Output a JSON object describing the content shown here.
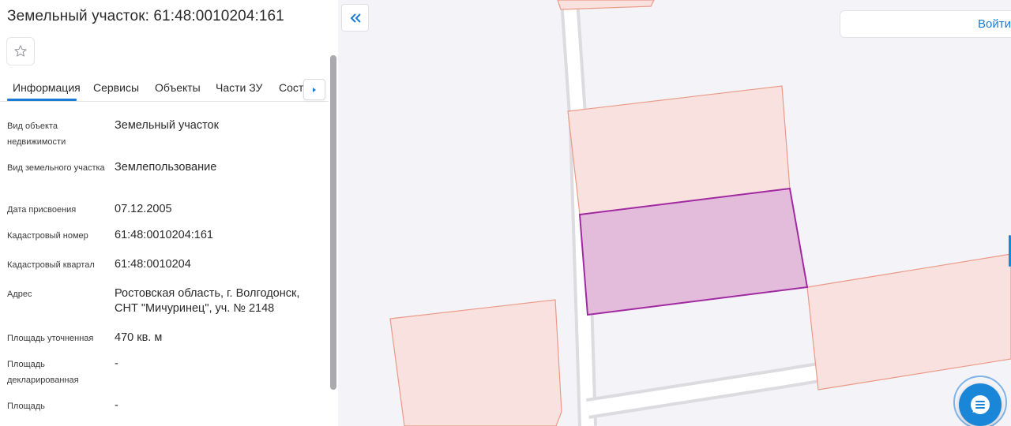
{
  "panel": {
    "title": "Земельный участок: 61:48:0010204:161",
    "tabs": [
      {
        "label": "Информация",
        "active": true
      },
      {
        "label": "Сервисы"
      },
      {
        "label": "Объекты"
      },
      {
        "label": "Части ЗУ"
      },
      {
        "label": "Соста"
      }
    ],
    "rows": [
      {
        "label": "Вид объекта недвижимости",
        "value": "Земельный участок"
      },
      {
        "label": "Вид земельного участка",
        "value": "Землепользование"
      },
      {
        "label": "Дата присвоения",
        "value": "07.12.2005"
      },
      {
        "label": "Кадастровый номер",
        "value": "61:48:0010204:161"
      },
      {
        "label": "Кадастровый квартал",
        "value": "61:48:0010204"
      },
      {
        "label": "Адрес",
        "value": "Ростовская область, г. Волгодонск, СНТ \"Мичуринец\", уч. № 2148"
      },
      {
        "label": "Площадь уточненная",
        "value": "470 кв. м"
      },
      {
        "label": "Площадь декларированная",
        "value": "-"
      },
      {
        "label": "Площадь",
        "value": "-"
      }
    ]
  },
  "header": {
    "login_label": "Войти"
  },
  "icons": {
    "favorite": "star-outline-icon",
    "tabs_next": "caret-right-icon",
    "collapse": "double-chevron-left-icon",
    "chat": "chat-bubble-icon"
  },
  "colors": {
    "accent": "#1a7bd5",
    "parcel_fill": "#f8e1de",
    "parcel_stroke": "#ec9a87",
    "selected_fill": "#e3bcdb",
    "selected_stroke": "#a12aa2"
  }
}
